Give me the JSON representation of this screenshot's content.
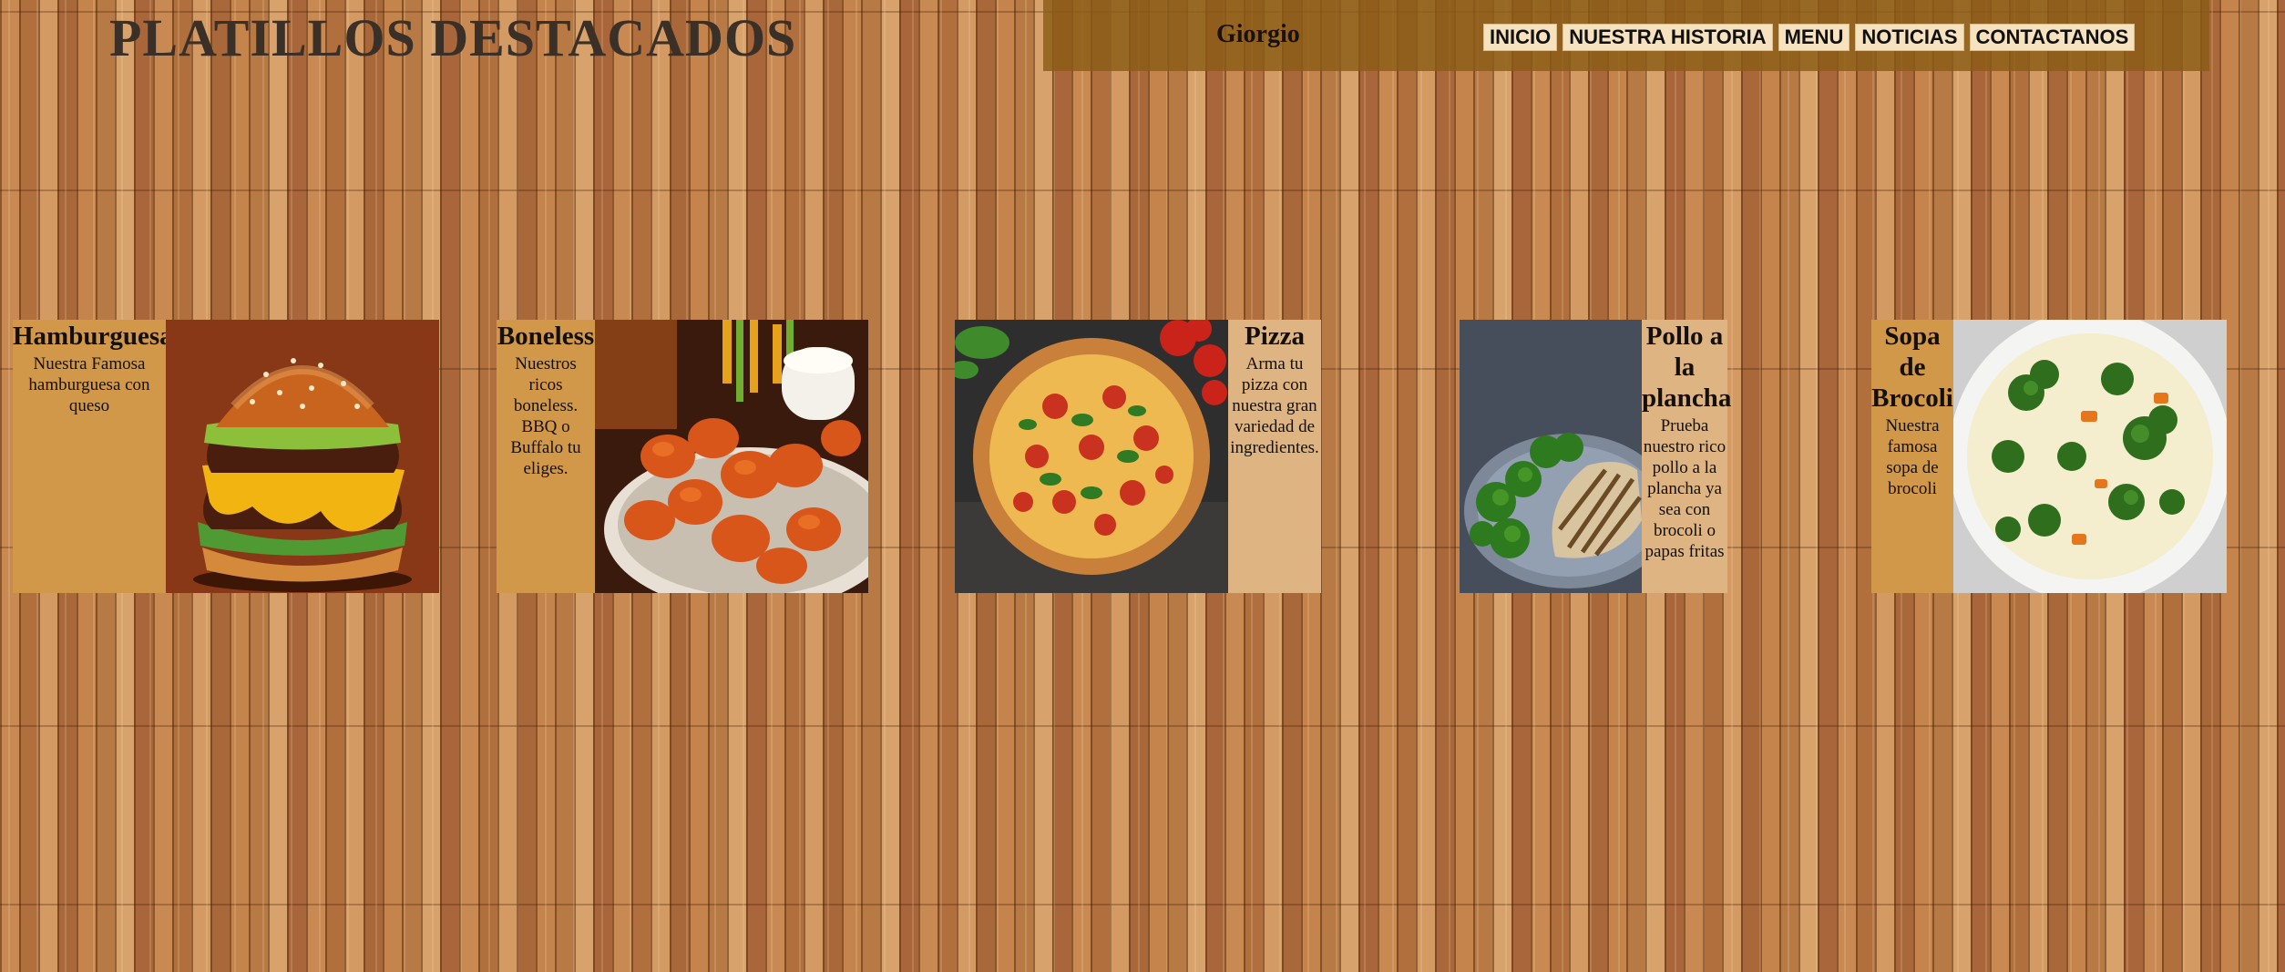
{
  "header": {
    "title": "PLATILLOS DESTACADOS",
    "brand": "Giorgio"
  },
  "nav": {
    "items": [
      {
        "label": "INICIO"
      },
      {
        "label": "NUESTRA HISTORIA"
      },
      {
        "label": "MENU"
      },
      {
        "label": "NOTICIAS"
      },
      {
        "label": "CONTACTANOS"
      }
    ]
  },
  "dishes": [
    {
      "name": "Hamburguesa",
      "description": "Nuestra Famosa hamburguesa con queso",
      "icon": "burger-image"
    },
    {
      "name": "Boneless",
      "description": "Nuestros ricos boneless. BBQ o Buffalo tu eliges.",
      "icon": "boneless-image"
    },
    {
      "name": "Pizza",
      "description": "Arma tu pizza con nuestra gran variedad de ingredientes.",
      "icon": "pizza-image"
    },
    {
      "name": "Pollo a la plancha",
      "description": "Prueba nuestro rico pollo a la plancha ya sea con brocoli o papas fritas",
      "icon": "chicken-image"
    },
    {
      "name": "Sopa de Brocoli",
      "description": "Nuestra famosa sopa de brocoli",
      "icon": "soup-image"
    }
  ],
  "colors": {
    "nav_bar": "#8a5c16",
    "nav_link_bg": "#f6e2bf",
    "card_dark": "#d1984a",
    "card_light": "#deb483",
    "title": "#3b3028"
  }
}
